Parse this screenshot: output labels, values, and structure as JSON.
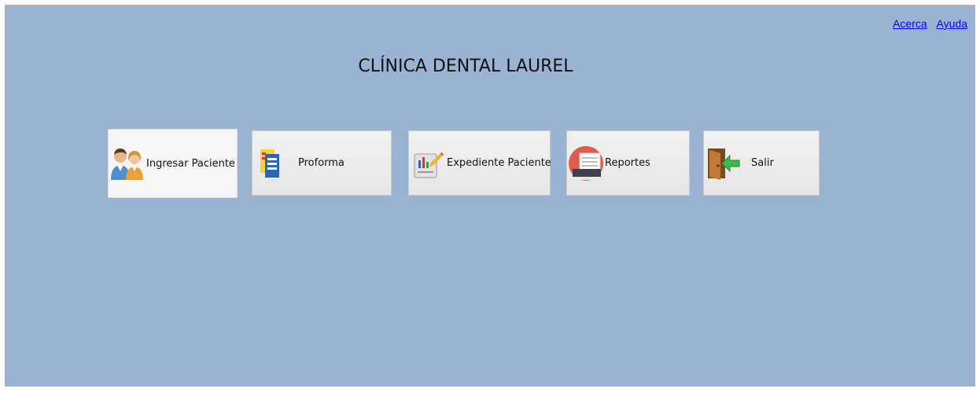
{
  "header": {
    "links": [
      {
        "label": "Acerca"
      },
      {
        "label": "Ayuda"
      }
    ],
    "title": "CLÍNICA DENTAL LAUREL"
  },
  "menu": {
    "buttons": [
      {
        "label": "Ingresar Paciente",
        "icon": "patients-icon"
      },
      {
        "label": "Proforma",
        "icon": "proforma-icon"
      },
      {
        "label": "Expediente Paciente",
        "icon": "record-icon"
      },
      {
        "label": "Reportes",
        "icon": "reports-icon"
      },
      {
        "label": "Salir",
        "icon": "exit-door-icon"
      }
    ]
  },
  "colors": {
    "background": "#9ab3d3",
    "button": "#ececec",
    "link": "#0000ee"
  }
}
